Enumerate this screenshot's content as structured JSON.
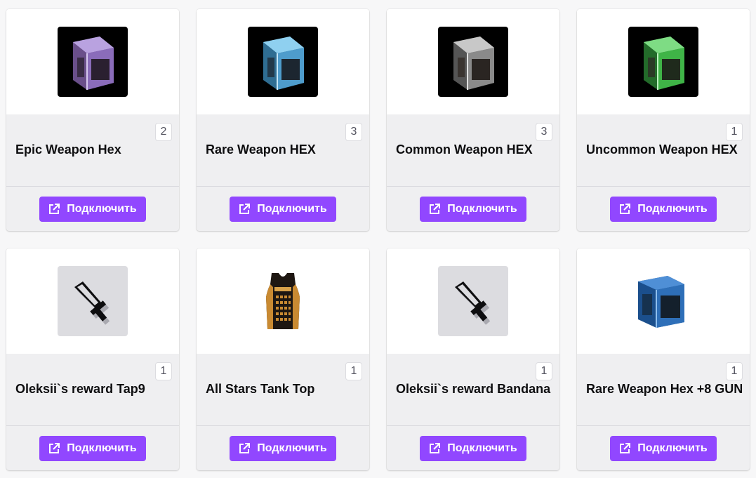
{
  "cards": [
    {
      "title": "Epic Weapon Hex",
      "count": "2",
      "image": "epic-weapon-hex-crate",
      "accent": "#a58ad6",
      "button_label": "Подключить",
      "button_icon": "external-link-icon"
    },
    {
      "title": "Rare Weapon HEX",
      "count": "3",
      "image": "rare-weapon-hex-crate",
      "accent": "#5fa9d8",
      "button_label": "Подключить",
      "button_icon": "external-link-icon"
    },
    {
      "title": "Common Weapon HEX",
      "count": "3",
      "image": "common-weapon-hex-crate",
      "accent": "#9a9a9a",
      "button_label": "Подключить",
      "button_icon": "external-link-icon"
    },
    {
      "title": "Uncommon Weapon HEX",
      "count": "1",
      "image": "uncommon-weapon-hex-crate",
      "accent": "#3fb447",
      "button_label": "Подключить",
      "button_icon": "external-link-icon"
    },
    {
      "title": "Oleksii`s reward Tap9",
      "count": "1",
      "image": "sword-placeholder-icon",
      "accent": "#dcdce0",
      "button_label": "Подключить",
      "button_icon": "external-link-icon"
    },
    {
      "title": "All Stars Tank Top",
      "count": "1",
      "image": "all-stars-tank-top",
      "accent": "#c98a32",
      "button_label": "Подключить",
      "button_icon": "external-link-icon"
    },
    {
      "title": "Oleksii`s reward Bandana",
      "count": "1",
      "image": "sword-placeholder-icon",
      "accent": "#dcdce0",
      "button_label": "Подключить",
      "button_icon": "external-link-icon"
    },
    {
      "title": "Rare Weapon Hex +8 GUN",
      "count": "1",
      "image": "rare-weapon-hex-crate-blue",
      "accent": "#2e6fb8",
      "button_label": "Подключить",
      "button_icon": "external-link-icon"
    }
  ],
  "theme": {
    "button_color": "#9147ff",
    "card_background": "#efeff1",
    "image_background": "#ffffff"
  }
}
